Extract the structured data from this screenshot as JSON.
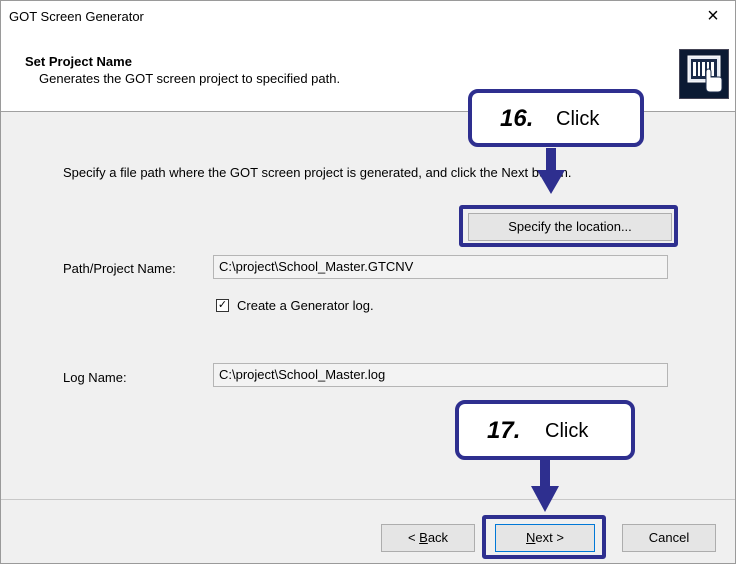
{
  "window": {
    "title": "GOT Screen Generator",
    "close_glyph": "×"
  },
  "header": {
    "title": "Set Project Name",
    "subtitle": "Generates the GOT screen project to specified path.",
    "icon": "touch-panel-icon"
  },
  "main": {
    "instruction": "Specify a file path where the GOT screen project is generated, and click the Next button.",
    "specify_button_label": "Specify the location...",
    "path_label": "Path/Project Name:",
    "path_value": "C:\\project\\School_Master.GTCNV",
    "create_log_checked": true,
    "create_log_label": "Create a Generator log.",
    "log_label": "Log Name:",
    "log_value": "C:\\project\\School_Master.log"
  },
  "footer": {
    "back_label_prefix": "< ",
    "back_label_key": "B",
    "back_label_rest": "ack",
    "next_label_key": "N",
    "next_label_rest": "ext >",
    "cancel_label": "Cancel"
  },
  "annotations": {
    "step16_number": "16.",
    "step16_text": "Click",
    "step17_number": "17.",
    "step17_text": "Click",
    "color": "#2e2f8f"
  }
}
